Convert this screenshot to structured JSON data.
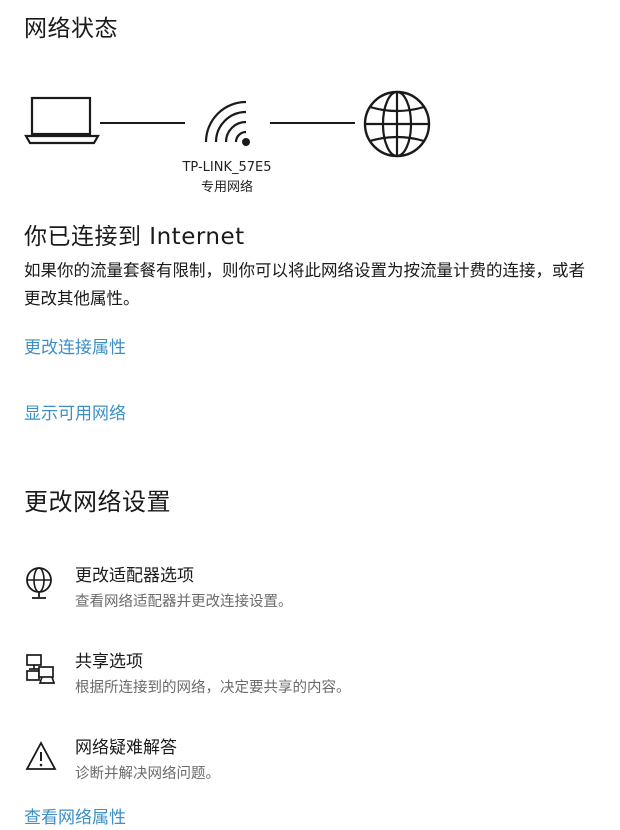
{
  "status": {
    "heading": "网络状态",
    "network_name": "TP-LINK_57E5",
    "network_type": "专用网络",
    "connected_text": "你已连接到 Internet",
    "description": "如果你的流量套餐有限制，则你可以将此网络设置为按流量计费的连接，或者更改其他属性。",
    "change_properties_link": "更改连接属性",
    "show_networks_link": "显示可用网络"
  },
  "settings": {
    "heading": "更改网络设置",
    "items": [
      {
        "icon": "adapter-globe-icon",
        "title": "更改适配器选项",
        "desc": "查看网络适配器并更改连接设置。"
      },
      {
        "icon": "sharing-icon",
        "title": "共享选项",
        "desc": "根据所连接到的网络，决定要共享的内容。"
      },
      {
        "icon": "warning-icon",
        "title": "网络疑难解答",
        "desc": "诊断并解决网络问题。"
      }
    ],
    "view_properties_link": "查看网络属性"
  },
  "colors": {
    "link": "#3d8fc6",
    "text": "#1a1a1a",
    "secondary": "#6b6b6b"
  }
}
